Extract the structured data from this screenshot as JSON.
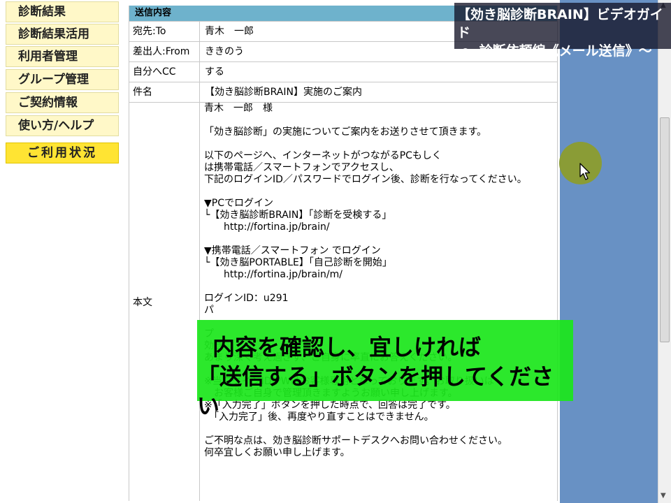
{
  "sidebar": {
    "items": [
      {
        "label": "診断結果"
      },
      {
        "label": "診断結果活用"
      },
      {
        "label": "利用者管理"
      },
      {
        "label": "グループ管理"
      },
      {
        "label": "ご契約情報"
      },
      {
        "label": "使い方/ヘルプ"
      }
    ],
    "status_button": "ご利用状況"
  },
  "form": {
    "header": "送信内容",
    "to_label": "宛先:To",
    "to_value": "青木　一郎",
    "from_label": "差出人:From",
    "from_value": "ききのう",
    "cc_label": "自分へCC",
    "cc_value": "する",
    "subject_label": "件名",
    "subject_value": "【効き脳診断BRAIN】実施のご案内",
    "body_label": "本文",
    "body_lines": [
      "青木　一郎　様",
      "",
      "「効き脳診断」の実施についてご案内をお送りさせて頂きます。",
      "",
      "以下のページへ、インターネットがつながるPCもしく",
      "は携帯電話／スマートフォンでアクセスし、",
      "下記のログインID／パスワードでログイン後、診断を行なってください。",
      "",
      "▼PCでログイン",
      "└【効き脳診断BRAIN】「診断を受検する」",
      "　　http://fortina.jp/brain/",
      "",
      "▼携帯電話／スマートフォン でログイン",
      "└【効き脳PORTABLE】「自己診断を開始」",
      "　　http://fortina.jp/brain/m/",
      "",
      "ログインID：u291",
      "パ",
      "",
      "プ",
      "効き",
      "あまり深く考え過ぎず、ご自身に率直にお答えください。",
      "",
      "※当ログインID/PWはお客様専用となっております。お取り扱いは",
      "　お客様ご自身で管理頂きますようお願い申し上げます。",
      "※「入力完了」ボタンを押した時点で、回答は完了です。",
      "　「入力完了」後、再度やり直すことはできません。",
      "",
      "ご不明な点は、効き脳診断サポートデスクへお問い合わせください。",
      "何卒宜しくお願い申し上げます。"
    ]
  },
  "overlay": {
    "guide_line1": "【効き脳診断BRAIN】ビデオガイド",
    "guide_line2": "〜 診断依頼編《メール送信》〜",
    "instruction_line1": "内容を確認し、宜しければ",
    "instruction_line2": "「送信する」ボタンを押してください"
  },
  "colors": {
    "form_header": "#6eb2cc",
    "sidebar_item": "#fff8c8",
    "sidebar_active": "#ffe433",
    "right_panel": "#6891c4",
    "instruction_bg": "#1ce61c"
  }
}
